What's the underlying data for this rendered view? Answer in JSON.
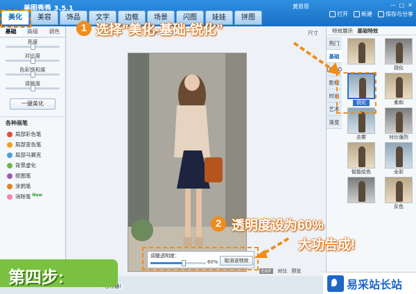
{
  "app": {
    "title": "美图秀秀 3.5.1",
    "user": "黄思思"
  },
  "tabs": [
    "美化",
    "美容",
    "饰品",
    "文字",
    "边框",
    "场景",
    "闪图",
    "娃娃",
    "拼图"
  ],
  "top_actions": {
    "open": "打开",
    "new": "新建",
    "save": "保存与分享"
  },
  "left_panel": {
    "subtabs": [
      "基础",
      "高级",
      "调色"
    ],
    "sliders": [
      {
        "label": "亮度",
        "value": 0.5
      },
      {
        "label": "对比度",
        "value": 0.5
      },
      {
        "label": "色彩饱和度",
        "value": 0.5
      },
      {
        "label": "清晰度",
        "value": 0.5
      }
    ],
    "one_key_button": "一键美化",
    "brush_heading": "各种画笔",
    "brushes": [
      {
        "label": "局部彩色笔",
        "color": "#e84c3d"
      },
      {
        "label": "局部变色笔",
        "color": "#f0a020"
      },
      {
        "label": "局部马赛克",
        "color": "#4aa3df"
      },
      {
        "label": "背景虚化",
        "color": "#66bb44"
      },
      {
        "label": "抠图笔",
        "color": "#9b59b6"
      },
      {
        "label": "涂鸦笔",
        "color": "#e67e22"
      },
      {
        "label": "消除笔",
        "color": "#ff7fb0",
        "badge": "New"
      }
    ]
  },
  "canvas": {
    "toolbar_left": "原大",
    "toolbar_right": "尺寸"
  },
  "right_panel": {
    "header": "特效展示",
    "header_sel": "基础特效",
    "categories": [
      "热门",
      "基础",
      "LOMO",
      "影楼",
      "时尚",
      "艺术",
      "渐变"
    ],
    "selected_category": 1,
    "thumbs": [
      {
        "label": "",
        "tone": "warm"
      },
      {
        "label": "锐化",
        "tone": "gray"
      },
      {
        "label": "锐化",
        "tone": "cool",
        "selected": true
      },
      {
        "label": "柔和",
        "tone": "warm"
      },
      {
        "label": "去雾",
        "tone": "cool"
      },
      {
        "label": "对比强烈",
        "tone": "gray"
      },
      {
        "label": "智能绘色",
        "tone": "warm"
      },
      {
        "label": "全彩",
        "tone": "cool"
      },
      {
        "label": "",
        "tone": "gray"
      },
      {
        "label": "反色",
        "tone": "warm"
      }
    ]
  },
  "opacity": {
    "label": "调整透明度：",
    "value_text": "60%",
    "value": 0.6,
    "cancel": "取消该特效"
  },
  "bottom_tools": {
    "exif": "EXIF",
    "compare": "对比",
    "preview": "预览"
  },
  "annotations": {
    "step1_num": "1",
    "step1_text": "选择”美化-基础-锐化”",
    "step2_num": "2",
    "step2_line1": "透明度设为60%",
    "step2_line2": "大功告成!"
  },
  "banner": {
    "text": "第四步:"
  },
  "brand": {
    "text": "易采站长站"
  },
  "bottom_fragment": "容神器!",
  "colors": {
    "accent": "#f08c1a",
    "banner": "#7ac142",
    "titlebar": "#1a6fc4"
  }
}
